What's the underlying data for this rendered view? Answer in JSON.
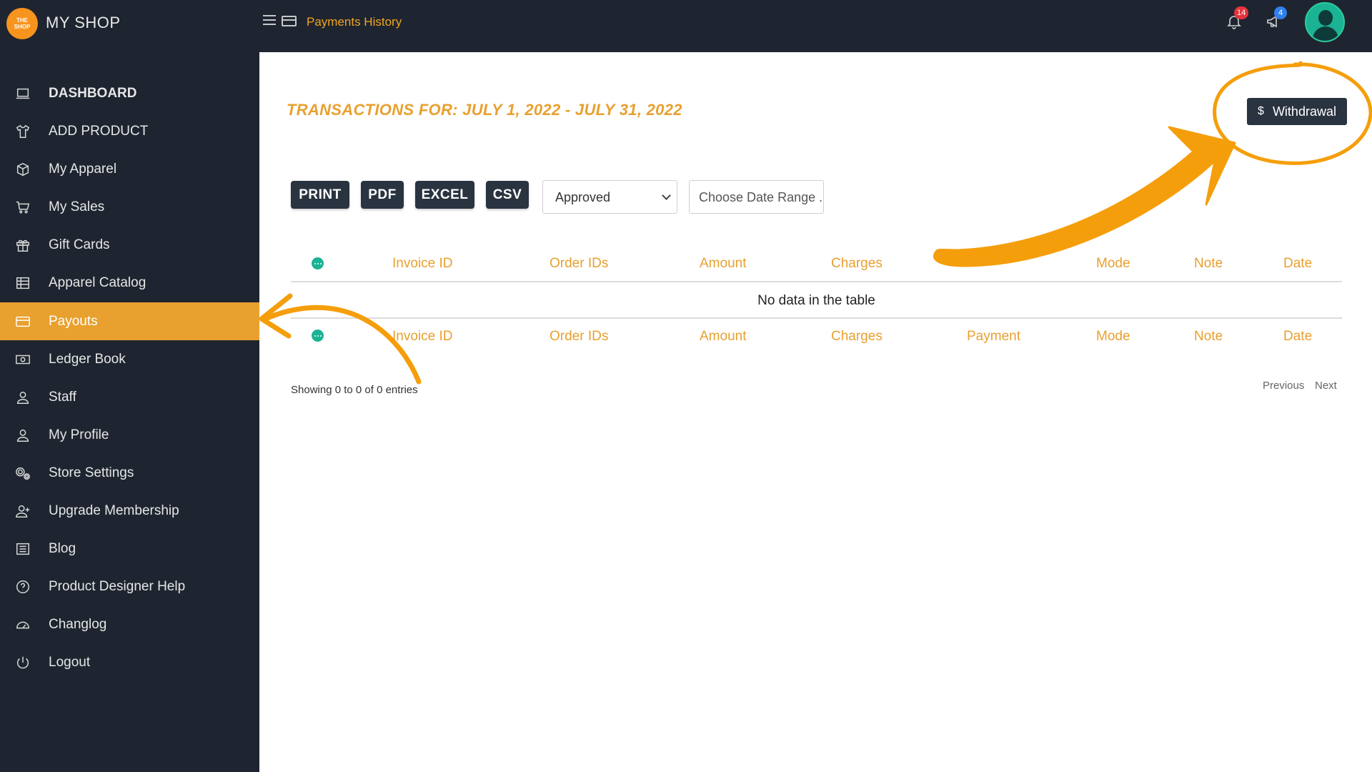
{
  "header": {
    "logo_text": "THE SHOP",
    "brand": "MY SHOP",
    "breadcrumb": "Payments History",
    "notifications_count": "14",
    "announcements_count": "4"
  },
  "sidebar": {
    "items": [
      {
        "label": "DASHBOARD",
        "icon": "laptop-icon"
      },
      {
        "label": "ADD PRODUCT",
        "icon": "tshirt-icon"
      },
      {
        "label": "My Apparel",
        "icon": "box-icon"
      },
      {
        "label": "My Sales",
        "icon": "cart-icon"
      },
      {
        "label": "Gift Cards",
        "icon": "gift-icon"
      },
      {
        "label": "Apparel Catalog",
        "icon": "table-icon"
      },
      {
        "label": "Payouts",
        "icon": "credit-card-icon"
      },
      {
        "label": "Ledger Book",
        "icon": "money-icon"
      },
      {
        "label": "Staff",
        "icon": "user-icon"
      },
      {
        "label": "My Profile",
        "icon": "user-icon"
      },
      {
        "label": "Store Settings",
        "icon": "gears-icon"
      },
      {
        "label": "Upgrade Membership",
        "icon": "user-plus-icon"
      },
      {
        "label": "Blog",
        "icon": "list-icon"
      },
      {
        "label": "Product Designer Help",
        "icon": "help-circle-icon"
      },
      {
        "label": "Changlog",
        "icon": "gauge-icon"
      },
      {
        "label": "Logout",
        "icon": "power-icon"
      }
    ],
    "active": "Payouts"
  },
  "main": {
    "title": "TRANSACTIONS FOR: JULY 1, 2022 - JULY 31, 2022",
    "withdraw_button": {
      "symbol": "$",
      "label": "Withdrawal"
    },
    "export_buttons": [
      "PRINT",
      "PDF",
      "EXCEL",
      "CSV"
    ],
    "status_select": {
      "value": "Approved"
    },
    "date_range": {
      "placeholder": "Choose Date Range .."
    },
    "table": {
      "header_columns": [
        "Invoice ID",
        "Order IDs",
        "Amount",
        "Charges",
        "Mode",
        "Note",
        "Date"
      ],
      "footer_columns": [
        "Invoice ID",
        "Order IDs",
        "Amount",
        "Charges",
        "Payment",
        "Mode",
        "Note",
        "Date"
      ],
      "empty_message": "No data in the table"
    },
    "info": "Showing 0 to 0 of 0 entries",
    "pagination": {
      "previous": "Previous",
      "next": "Next"
    }
  },
  "colors": {
    "accent": "#e8a02f",
    "sidebar_bg": "#1e2530",
    "button_dark": "#2a3340",
    "teal": "#1ab394",
    "annotation_orange": "#f59e0b"
  }
}
